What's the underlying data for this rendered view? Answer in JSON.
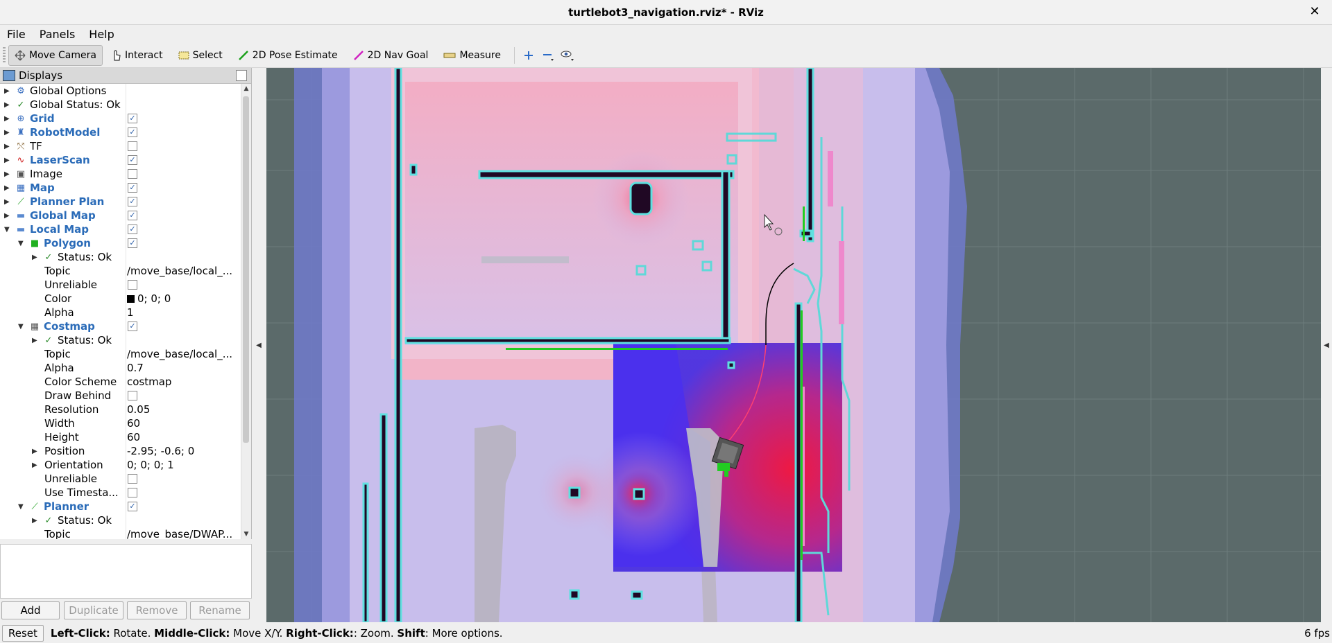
{
  "window": {
    "title": "turtlebot3_navigation.rviz* - RViz",
    "close_label": "✕"
  },
  "menu": [
    "File",
    "Panels",
    "Help"
  ],
  "toolbar": {
    "tools": [
      {
        "label": "Move Camera",
        "icon": "move-camera-icon",
        "active": true
      },
      {
        "label": "Interact",
        "icon": "interact-icon"
      },
      {
        "label": "Select",
        "icon": "select-icon"
      },
      {
        "label": "2D Pose Estimate",
        "icon": "pose-estimate-icon"
      },
      {
        "label": "2D Nav Goal",
        "icon": "nav-goal-icon"
      },
      {
        "label": "Measure",
        "icon": "measure-icon"
      }
    ]
  },
  "displays": {
    "title": "Displays",
    "rows": [
      {
        "depth": 0,
        "arrow": "▶",
        "icon": "⚙",
        "icon_color": "#3a6fc0",
        "label": "Global Options",
        "blue": false,
        "check": null,
        "value": ""
      },
      {
        "depth": 0,
        "arrow": "▶",
        "icon": "✓",
        "icon_color": "#2a8a2a",
        "label": "Global Status: Ok",
        "blue": false,
        "check": null,
        "value": ""
      },
      {
        "depth": 0,
        "arrow": "▶",
        "icon": "⊕",
        "icon_color": "#3a6fc0",
        "label": "Grid",
        "blue": true,
        "check": true,
        "value": ""
      },
      {
        "depth": 0,
        "arrow": "▶",
        "icon": "♜",
        "icon_color": "#3a6fc0",
        "label": "RobotModel",
        "blue": true,
        "check": true,
        "value": ""
      },
      {
        "depth": 0,
        "arrow": "▶",
        "icon": "⤲",
        "icon_color": "#8a6a3a",
        "label": "TF",
        "blue": false,
        "check": false,
        "value": ""
      },
      {
        "depth": 0,
        "arrow": "▶",
        "icon": "∿",
        "icon_color": "#d02020",
        "label": "LaserScan",
        "blue": true,
        "check": true,
        "value": ""
      },
      {
        "depth": 0,
        "arrow": "▶",
        "icon": "▣",
        "icon_color": "#555555",
        "label": "Image",
        "blue": false,
        "check": false,
        "value": ""
      },
      {
        "depth": 0,
        "arrow": "▶",
        "icon": "▦",
        "icon_color": "#3a6fc0",
        "label": "Map",
        "blue": true,
        "check": true,
        "value": ""
      },
      {
        "depth": 0,
        "arrow": "▶",
        "icon": "⟋",
        "icon_color": "#20a020",
        "label": "Planner Plan",
        "blue": true,
        "check": true,
        "value": ""
      },
      {
        "depth": 0,
        "arrow": "▶",
        "icon": "▬",
        "icon_color": "#5a8ad0",
        "label": "Global Map",
        "blue": true,
        "check": true,
        "value": ""
      },
      {
        "depth": 0,
        "arrow": "▼",
        "icon": "▬",
        "icon_color": "#5a8ad0",
        "label": "Local Map",
        "blue": true,
        "check": true,
        "value": ""
      },
      {
        "depth": 1,
        "arrow": "▼",
        "icon": "■",
        "icon_color": "#20b020",
        "label": "Polygon",
        "blue": true,
        "check": true,
        "value": ""
      },
      {
        "depth": 2,
        "arrow": "▶",
        "icon": "✓",
        "icon_color": "#2a8a2a",
        "label": "Status: Ok",
        "blue": false,
        "check": null,
        "value": ""
      },
      {
        "depth": 2,
        "arrow": "",
        "icon": "",
        "icon_color": "",
        "label": "Topic",
        "blue": false,
        "check": null,
        "value": "/move_base/local_..."
      },
      {
        "depth": 2,
        "arrow": "",
        "icon": "",
        "icon_color": "",
        "label": "Unreliable",
        "blue": false,
        "check": false,
        "value": ""
      },
      {
        "depth": 2,
        "arrow": "",
        "icon": "",
        "icon_color": "",
        "label": "Color",
        "blue": false,
        "check": null,
        "value": "0; 0; 0",
        "swatch": "#000000"
      },
      {
        "depth": 2,
        "arrow": "",
        "icon": "",
        "icon_color": "",
        "label": "Alpha",
        "blue": false,
        "check": null,
        "value": "1"
      },
      {
        "depth": 1,
        "arrow": "▼",
        "icon": "▦",
        "icon_color": "#555555",
        "label": "Costmap",
        "blue": true,
        "check": true,
        "value": ""
      },
      {
        "depth": 2,
        "arrow": "▶",
        "icon": "✓",
        "icon_color": "#2a8a2a",
        "label": "Status: Ok",
        "blue": false,
        "check": null,
        "value": ""
      },
      {
        "depth": 2,
        "arrow": "",
        "icon": "",
        "icon_color": "",
        "label": "Topic",
        "blue": false,
        "check": null,
        "value": "/move_base/local_..."
      },
      {
        "depth": 2,
        "arrow": "",
        "icon": "",
        "icon_color": "",
        "label": "Alpha",
        "blue": false,
        "check": null,
        "value": "0.7"
      },
      {
        "depth": 2,
        "arrow": "",
        "icon": "",
        "icon_color": "",
        "label": "Color Scheme",
        "blue": false,
        "check": null,
        "value": "costmap"
      },
      {
        "depth": 2,
        "arrow": "",
        "icon": "",
        "icon_color": "",
        "label": "Draw Behind",
        "blue": false,
        "check": false,
        "value": ""
      },
      {
        "depth": 2,
        "arrow": "",
        "icon": "",
        "icon_color": "",
        "label": "Resolution",
        "blue": false,
        "check": null,
        "value": "0.05"
      },
      {
        "depth": 2,
        "arrow": "",
        "icon": "",
        "icon_color": "",
        "label": "Width",
        "blue": false,
        "check": null,
        "value": "60"
      },
      {
        "depth": 2,
        "arrow": "",
        "icon": "",
        "icon_color": "",
        "label": "Height",
        "blue": false,
        "check": null,
        "value": "60"
      },
      {
        "depth": 2,
        "arrow": "▶",
        "icon": "",
        "icon_color": "",
        "label": "Position",
        "blue": false,
        "check": null,
        "value": "-2.95; -0.6; 0"
      },
      {
        "depth": 2,
        "arrow": "▶",
        "icon": "",
        "icon_color": "",
        "label": "Orientation",
        "blue": false,
        "check": null,
        "value": "0; 0; 0; 1"
      },
      {
        "depth": 2,
        "arrow": "",
        "icon": "",
        "icon_color": "",
        "label": "Unreliable",
        "blue": false,
        "check": false,
        "value": ""
      },
      {
        "depth": 2,
        "arrow": "",
        "icon": "",
        "icon_color": "",
        "label": "Use Timesta...",
        "blue": false,
        "check": false,
        "value": ""
      },
      {
        "depth": 1,
        "arrow": "▼",
        "icon": "⟋",
        "icon_color": "#20a020",
        "label": "Planner",
        "blue": true,
        "check": true,
        "value": ""
      },
      {
        "depth": 2,
        "arrow": "▶",
        "icon": "✓",
        "icon_color": "#2a8a2a",
        "label": "Status: Ok",
        "blue": false,
        "check": null,
        "value": ""
      },
      {
        "depth": 2,
        "arrow": "",
        "icon": "",
        "icon_color": "",
        "label": "Topic",
        "blue": false,
        "check": null,
        "value": "/move_base/DWAP..."
      }
    ]
  },
  "buttons": {
    "add": "Add",
    "duplicate": "Duplicate",
    "remove": "Remove",
    "rename": "Rename"
  },
  "status": {
    "reset": "Reset",
    "hint": [
      {
        "b": "Left-Click:",
        "t": " Rotate. "
      },
      {
        "b": "Middle-Click:",
        "t": " Move X/Y. "
      },
      {
        "b": "Right-Click:",
        "t": ": Zoom. "
      },
      {
        "b": "Shift",
        "t": ": More options."
      }
    ],
    "fps": "6 fps"
  },
  "colors": {
    "background": "#5b6a6a",
    "free_space": "#c4b8ee",
    "inflation": "#eab0cc",
    "wall": "#200824",
    "wall_outline": "#5fe0e0",
    "local_costmap_blue": "#3a28e0",
    "local_costmap_red": "#e0183c",
    "laser": "#22cc22",
    "plan": "#000000"
  }
}
